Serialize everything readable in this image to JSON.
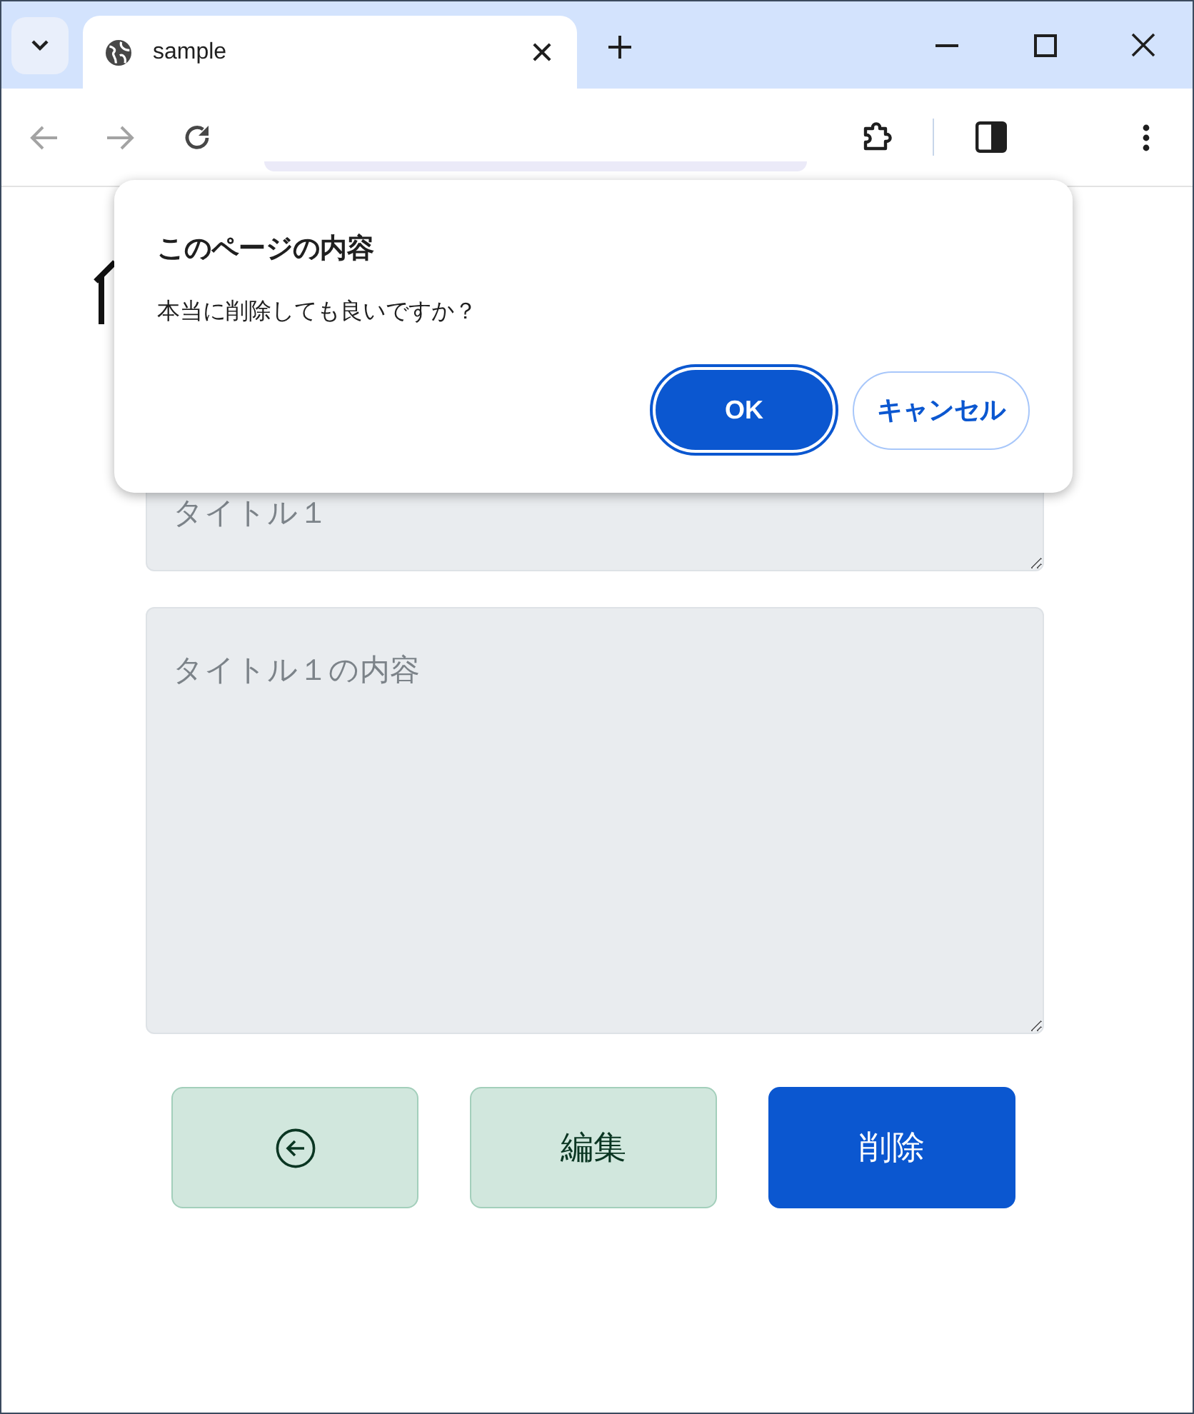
{
  "browser": {
    "tabs": [
      {
        "title": "sample",
        "selected": true
      }
    ]
  },
  "dialog": {
    "title": "このページの内容",
    "message": "本当に削除しても良いですか？",
    "buttons": [
      {
        "label": "OK",
        "kind": "primary",
        "focused": true
      },
      {
        "label": "キャンセル",
        "kind": "secondary",
        "focused": false
      }
    ]
  },
  "form": {
    "title_field": {
      "placeholder": "タイトル１"
    },
    "content_field": {
      "placeholder": "タイトル１の内容"
    }
  },
  "actions": [
    {
      "kind": "back"
    },
    {
      "kind": "edit",
      "label": "編集"
    },
    {
      "kind": "delete",
      "label": "削除"
    }
  ]
}
